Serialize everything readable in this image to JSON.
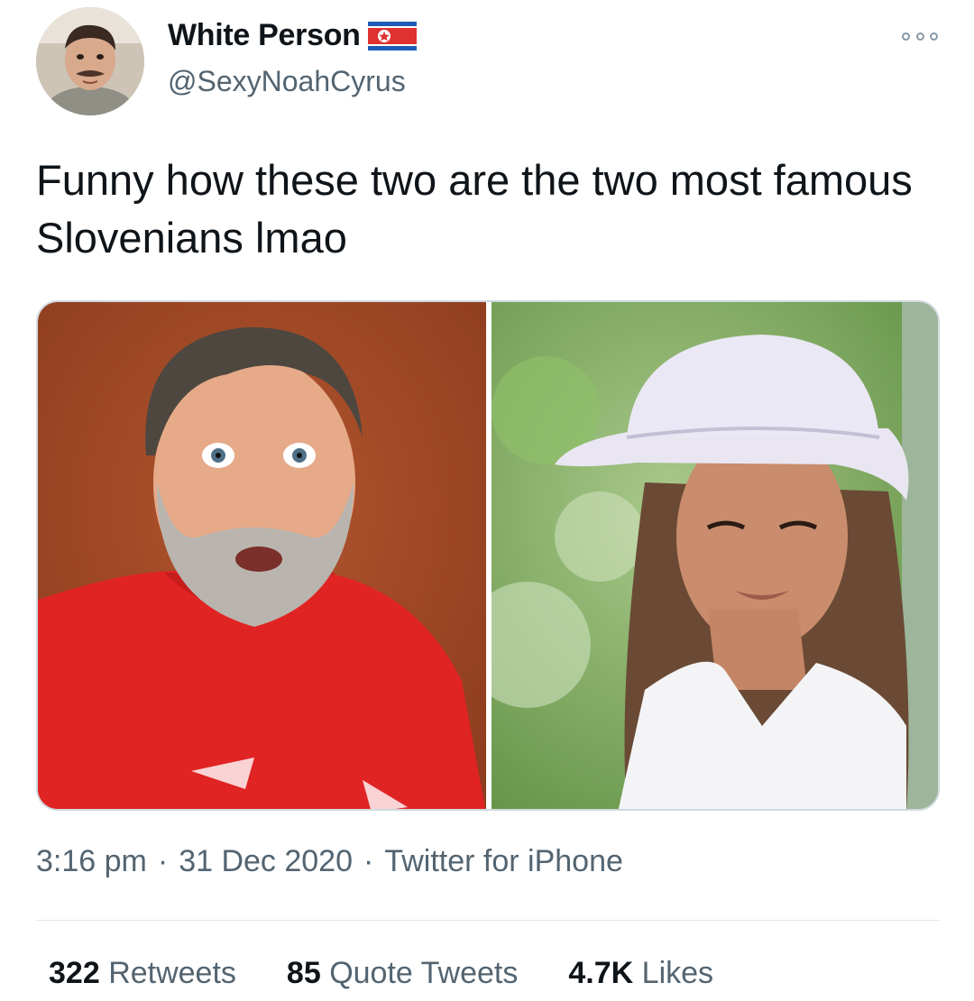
{
  "user": {
    "display_name": "White Person",
    "handle": "@SexyNoahCyrus",
    "avatar_icon": "profile-photo"
  },
  "tweet": {
    "text": "Funny how these two are the two most famous Slovenians lmao"
  },
  "media": {
    "left_photo": "man with grey beard in red t-shirt",
    "right_photo": "woman in white pith helmet and white shirt"
  },
  "meta": {
    "time": "3:16 pm",
    "date": "31 Dec 2020",
    "source": "Twitter for iPhone",
    "separator": "·"
  },
  "stats": {
    "retweets_count": "322",
    "retweets_label": "Retweets",
    "quotes_count": "85",
    "quotes_label": "Quote Tweets",
    "likes_count": "4.7K",
    "likes_label": "Likes"
  },
  "colors": {
    "text": "#0f1419",
    "secondary": "#536471",
    "flag_red": "#e03131",
    "flag_blue": "#1e5bb8"
  }
}
